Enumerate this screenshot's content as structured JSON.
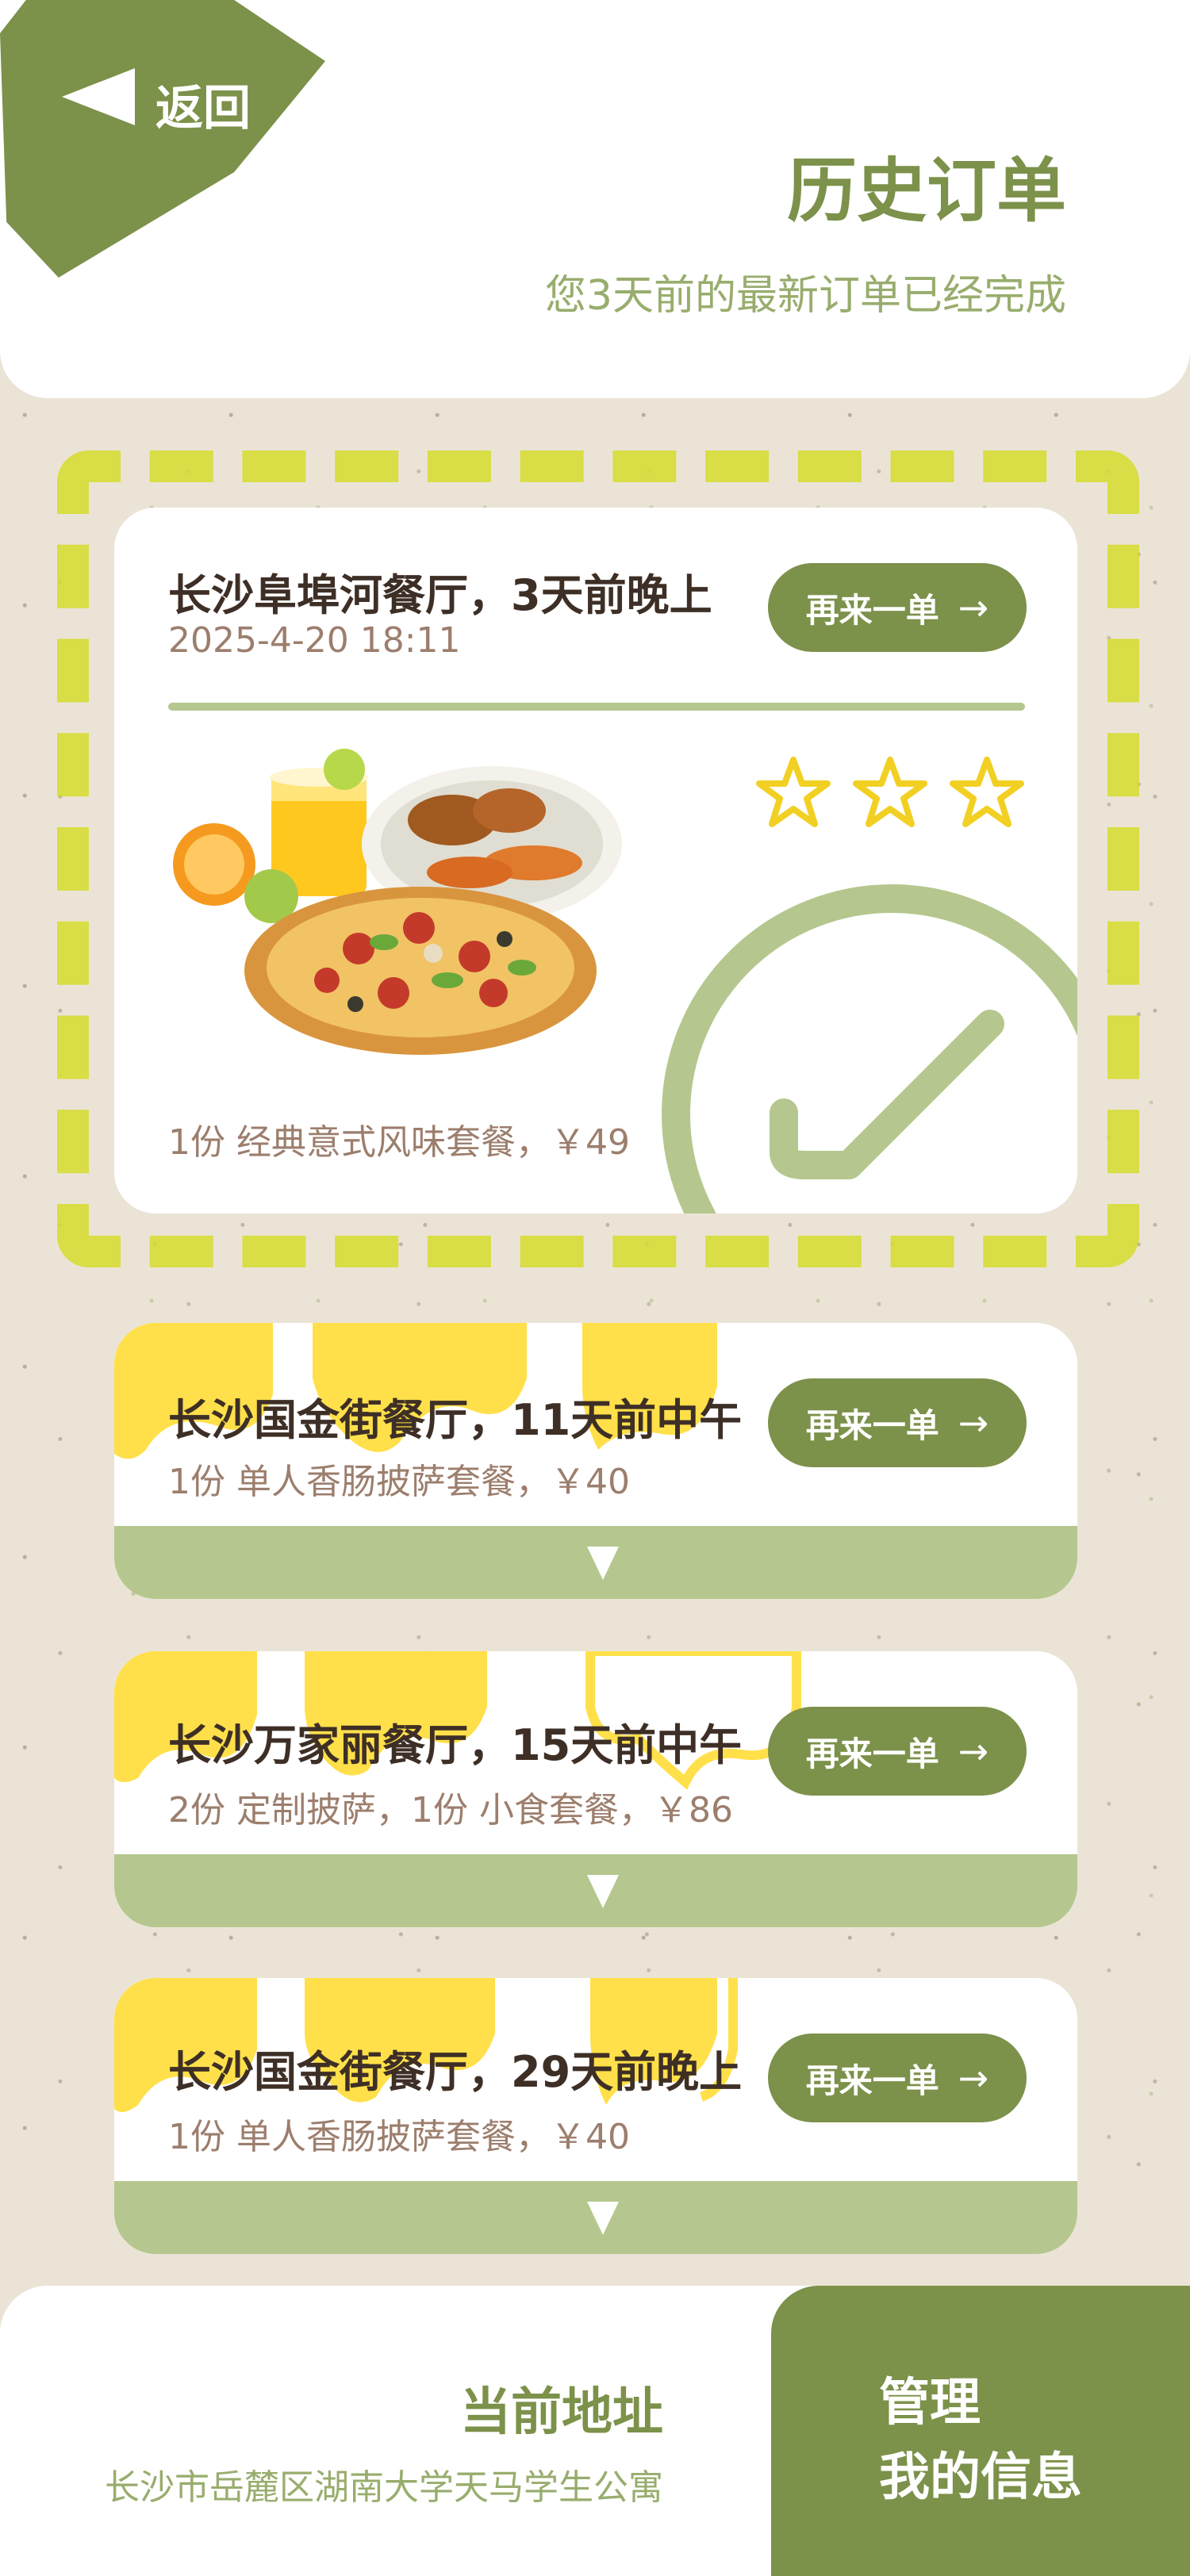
{
  "header": {
    "back_label": "返回",
    "title": "历史订单",
    "subtitle": "您3天前的最新订单已经完成"
  },
  "orders": [
    {
      "title": "长沙阜埠河餐厅，3天前晚上",
      "datetime": "2025-4-20 18:11",
      "items": "1份 经典意式风味套餐，￥49",
      "reorder_label": "再来一单",
      "rating": 3,
      "status": "completed"
    },
    {
      "title": "长沙国金街餐厅，11天前中午",
      "items": "1份 单人香肠披萨套餐，￥40",
      "reorder_label": "再来一单"
    },
    {
      "title": "长沙万家丽餐厅，15天前中午",
      "items": "2份 定制披萨，1份 小食套餐，￥86",
      "reorder_label": "再来一单"
    },
    {
      "title": "长沙国金街餐厅，29天前晚上",
      "items": "1份 单人香肠披萨套餐，￥40",
      "reorder_label": "再来一单"
    }
  ],
  "reorder_arrow": "→",
  "footer": {
    "address_title": "当前地址",
    "address": "长沙市岳麓区湖南大学天马学生公寓",
    "manage_line1": "管理",
    "manage_line2": "我的信息"
  },
  "colors": {
    "primary_green": "#7c914a",
    "light_green": "#b5c78e",
    "yellow": "#ffe04a",
    "star_yellow": "#f2d023",
    "background": "#ebe4d6"
  },
  "icons": {
    "back": "back-arrow-icon",
    "reorder": "arrow-right-icon",
    "rating": "star-icon",
    "status": "check-circle-icon",
    "expand": "chevron-down-icon"
  }
}
